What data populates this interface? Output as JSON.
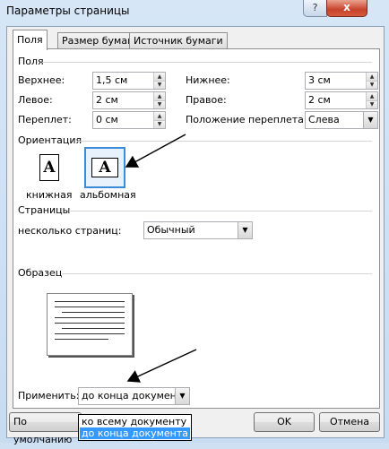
{
  "window": {
    "title": "Параметры страницы",
    "close": "x",
    "help": "?"
  },
  "tabs": [
    "Поля",
    "Размер бумаги",
    "Источник бумаги"
  ],
  "fields_group": {
    "title": "Поля",
    "top_label": "Верхнее:",
    "top_value": "1,5 см",
    "bottom_label": "Нижнее:",
    "bottom_value": "3 см",
    "left_label": "Левое:",
    "left_value": "2 см",
    "right_label": "Правое:",
    "right_value": "2 см",
    "gutter_label": "Переплет:",
    "gutter_value": "0 см",
    "gutter_pos_label": "Положение переплета:",
    "gutter_pos_value": "Слева"
  },
  "orientation": {
    "title": "Ориентация",
    "portrait_label": "книжная",
    "landscape_label": "альбомная",
    "icon_letter": "A"
  },
  "pages": {
    "title": "Страницы",
    "multiple_label": "несколько страниц:",
    "multiple_value": "Обычный"
  },
  "sample": {
    "title": "Образец"
  },
  "apply": {
    "label": "Применить:",
    "value": "до конца документа",
    "options": [
      "ко всему документу",
      "до конца документа"
    ]
  },
  "buttons": {
    "default": "По умолчанию",
    "ok": "OK",
    "cancel": "Отмена"
  },
  "colors": {
    "selection": "#3399ff",
    "title_bg": "#d6e6f7"
  }
}
